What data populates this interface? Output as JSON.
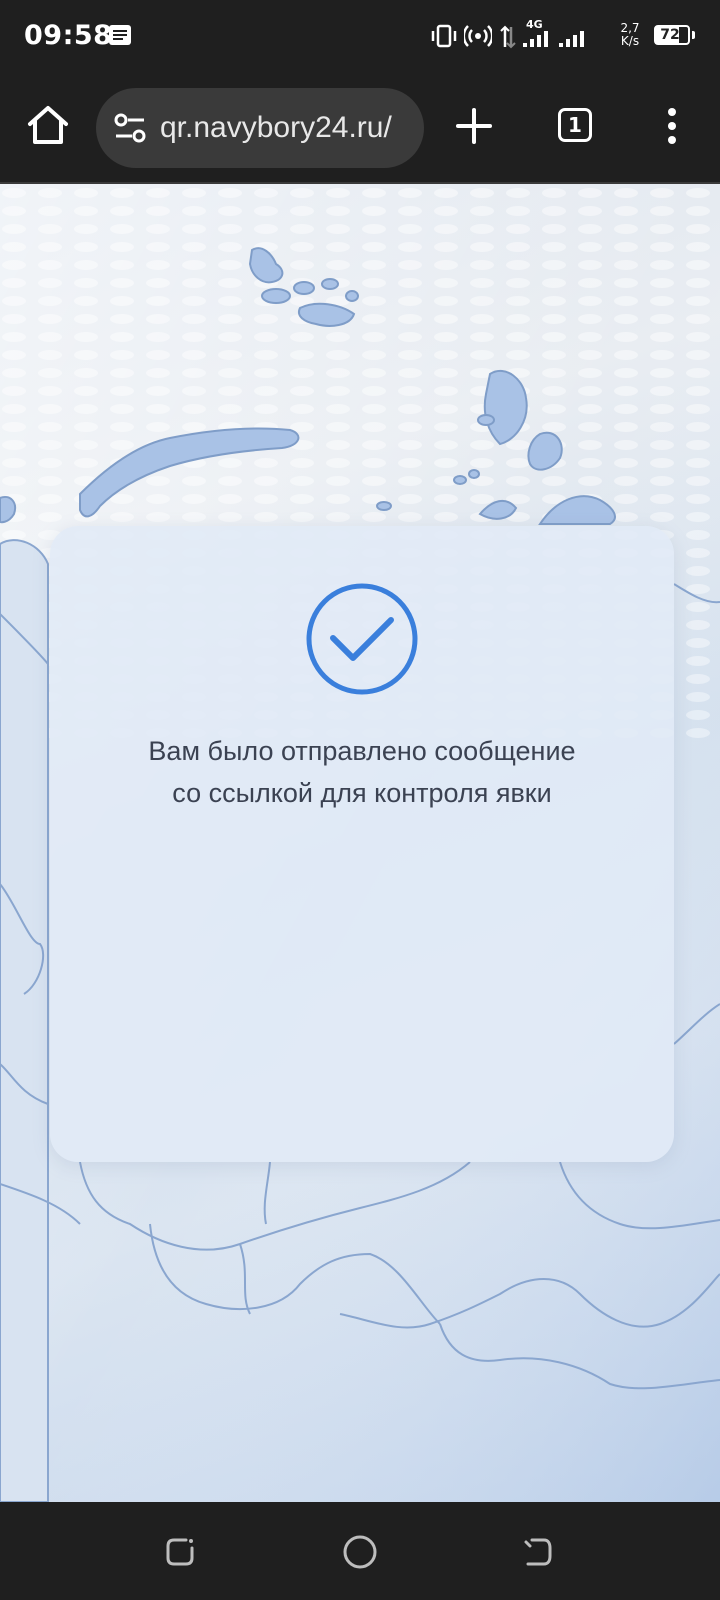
{
  "status_bar": {
    "time": "09:58",
    "network_type": "4G",
    "speed_value": "2,7",
    "speed_unit": "K/s",
    "battery": "72"
  },
  "browser": {
    "url": "qr.navybory24.ru/",
    "tab_count": "1"
  },
  "page": {
    "message_line1": "Вам было отправлено сообщение",
    "message_line2": "со ссылкой для контроля явки"
  },
  "colors": {
    "accent": "#3a7fdc",
    "chrome_bg": "#1f1f1f",
    "url_pill_bg": "#3a3a3a"
  },
  "icons": {
    "status_notification": "notification-icon",
    "vibrate": "vibrate-icon",
    "hotspot": "hotspot-icon",
    "home": "home-icon",
    "site_settings": "tune-icon",
    "new_tab": "plus-icon",
    "menu": "more-vert-icon",
    "success": "check-circle-icon"
  }
}
